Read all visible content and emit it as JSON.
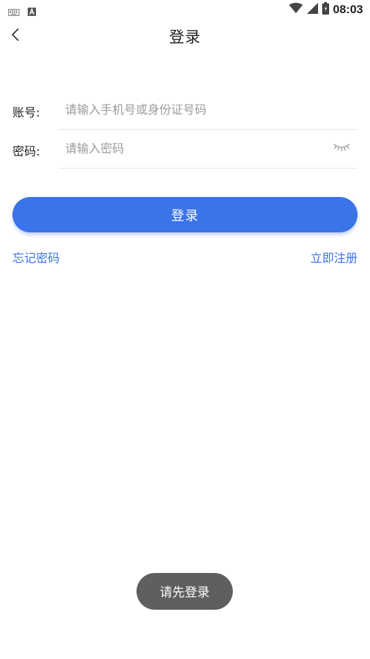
{
  "status_bar": {
    "time": "08:03",
    "icons": [
      "keyboard-icon",
      "a-icon",
      "wifi-icon",
      "signal-icon",
      "battery-icon"
    ]
  },
  "header": {
    "title": "登录",
    "back_icon": "back-icon"
  },
  "form": {
    "account": {
      "label": "账号:",
      "placeholder": "请输入手机号或身份证号码",
      "value": ""
    },
    "password": {
      "label": "密码:",
      "placeholder": "请输入密码",
      "value": "",
      "toggle_icon": "eye-closed-icon"
    }
  },
  "actions": {
    "login_label": "登录",
    "forgot_label": "忘记密码",
    "register_label": "立即注册"
  },
  "toast": {
    "message": "请先登录"
  },
  "colors": {
    "accent": "#3b73e8",
    "toast_bg": "#5f5f5f",
    "divider": "#e3e3e3"
  }
}
